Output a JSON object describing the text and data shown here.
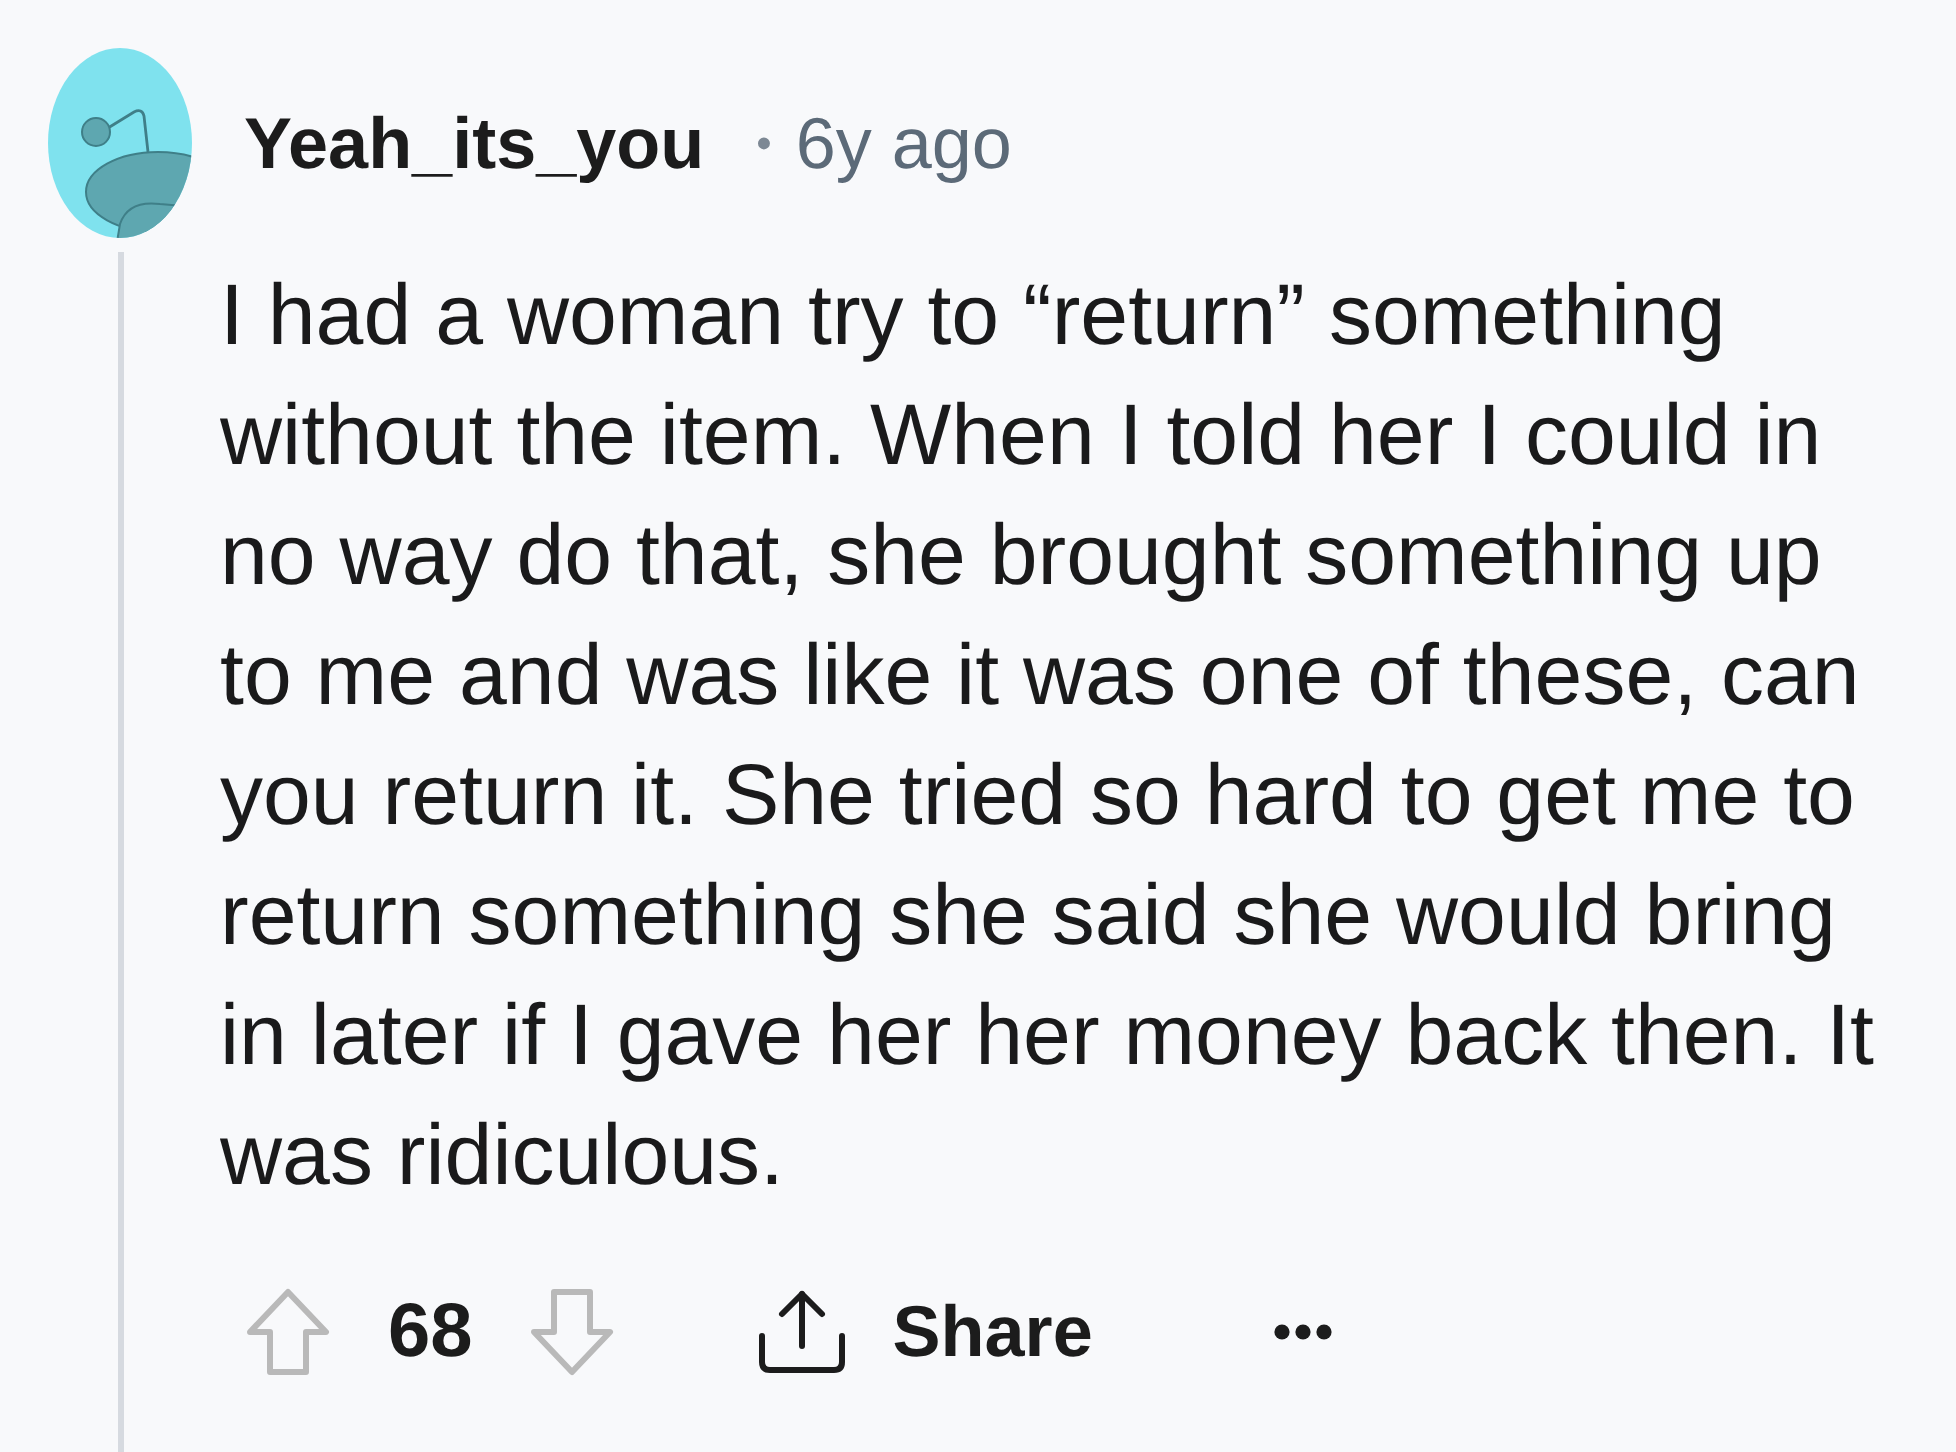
{
  "comment": {
    "author": "Yeah_its_you",
    "separator": "•",
    "age": "6y ago",
    "body": "I had a woman try to “return” something without the item. When I told her I could in no way do that, she brought something up to me and was like it was one of these, can you return it. She tried so hard to get me to return something she said she would bring in later if I gave her her money back then. It was ridiculous.",
    "score": "68",
    "actions": [
      {
        "kind": "share",
        "label": "Share"
      },
      {
        "kind": "more"
      }
    ]
  }
}
